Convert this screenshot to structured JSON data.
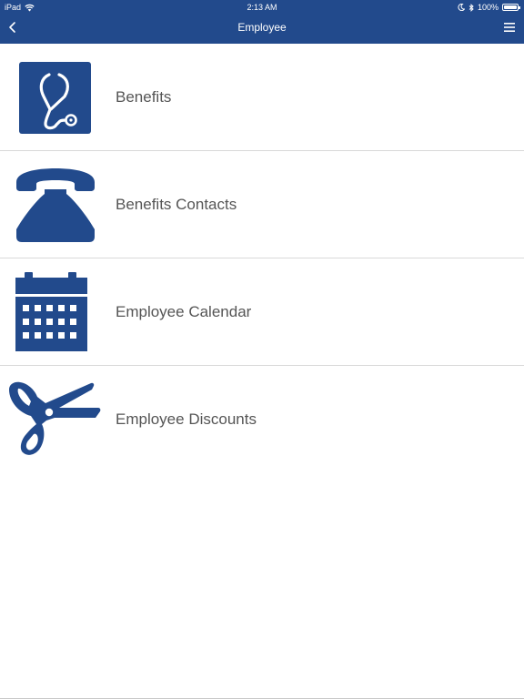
{
  "status_bar": {
    "carrier": "iPad",
    "time": "2:13 AM",
    "battery_percent": "100%"
  },
  "navbar": {
    "title": "Employee"
  },
  "colors": {
    "brand": "#224a8c",
    "icon": "#224a8c",
    "label": "#555555",
    "divider": "#d9d9d9"
  },
  "menu": {
    "items": [
      {
        "label": "Benefits",
        "icon": "stethoscope-icon"
      },
      {
        "label": "Benefits Contacts",
        "icon": "telephone-icon"
      },
      {
        "label": "Employee Calendar",
        "icon": "calendar-icon"
      },
      {
        "label": "Employee Discounts",
        "icon": "scissors-coupon-icon"
      }
    ]
  }
}
